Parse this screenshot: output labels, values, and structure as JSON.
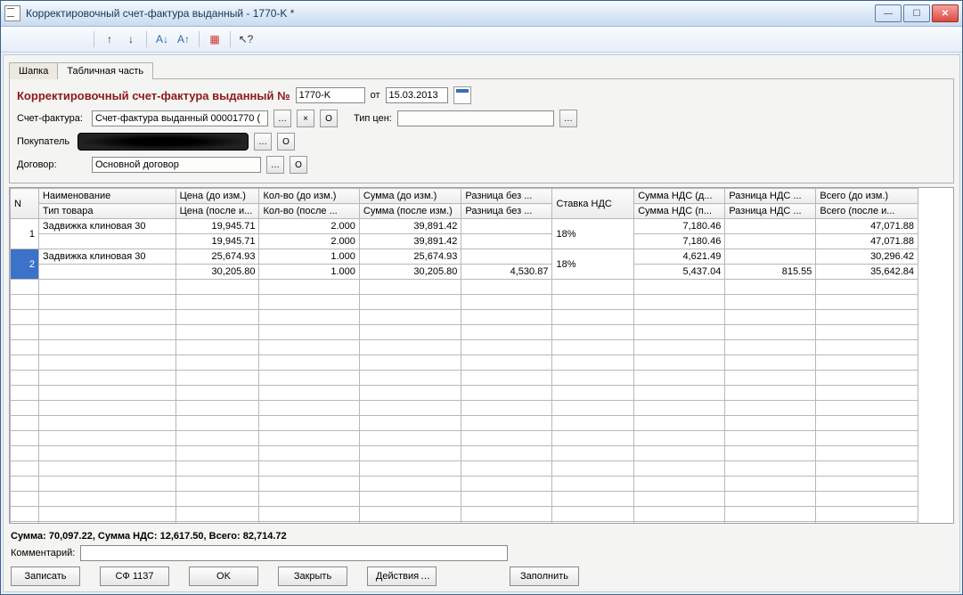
{
  "window": {
    "title": "Корректировочный счет-фактура выданный - 1770-K *"
  },
  "toolbar": {
    "buttons": [
      "grid1",
      "grid2",
      "grid3",
      "grid4",
      "up",
      "down",
      "sort-asc",
      "sort-desc",
      "props",
      "pointer"
    ]
  },
  "tabs": {
    "header": "Шапка",
    "table": "Табличная часть"
  },
  "doc": {
    "title_text": "Корректировочный счет-фактура выданный №",
    "number": "1770-K",
    "from_label": "от",
    "date": "15.03.2013",
    "invoice_label": "Счет-фактура:",
    "invoice_value": "Счет-фактура выданный 00001770 (",
    "pricetype_label": "Тип цен:",
    "pricetype_value": "",
    "buyer_label": "Покупатель",
    "contract_label": "Договор:",
    "contract_value": "Основной договор"
  },
  "columns": {
    "n": "N",
    "name_top": "Наименование",
    "name_bot": "Тип товара",
    "price_top": "Цена (до изм.)",
    "price_bot": "Цена (после и...",
    "qty_top": "Кол-во (до изм.)",
    "qty_bot": "Кол-во (после ...",
    "sum_top": "Сумма (до изм.)",
    "sum_bot": "Сумма (после изм.)",
    "diff_top": "Разница без ...",
    "diff_bot": "Разница без ...",
    "vat": "Ставка НДС",
    "vatsum_top": "Сумма НДС (д...",
    "vatsum_bot": "Сумма НДС (п...",
    "vatdiff_top": "Разница НДС ...",
    "vatdiff_bot": "Разница НДС ...",
    "total_top": "Всего (до изм.)",
    "total_bot": "Всего (после и..."
  },
  "rows": [
    {
      "n": "1",
      "name": "Задвижка клиновая 30",
      "price_b": "19,945.71",
      "price_a": "19,945.71",
      "qty_b": "2.000",
      "qty_a": "2.000",
      "sum_b": "39,891.42",
      "sum_a": "39,891.42",
      "diff_b": "",
      "diff_a": "",
      "vat": "18%",
      "vatsum_b": "7,180.46",
      "vatsum_a": "7,180.46",
      "vatdiff_b": "",
      "vatdiff_a": "",
      "total_b": "47,071.88",
      "total_a": "47,071.88"
    },
    {
      "n": "2",
      "name": "Задвижка клиновая 30",
      "price_b": "25,674.93",
      "price_a": "30,205.80",
      "qty_b": "1.000",
      "qty_a": "1.000",
      "sum_b": "25,674.93",
      "sum_a": "30,205.80",
      "diff_b": "",
      "diff_a": "4,530.87",
      "vat": "18%",
      "vatsum_b": "4,621.49",
      "vatsum_a": "5,437.04",
      "vatdiff_b": "",
      "vatdiff_a": "815.55",
      "total_b": "30,296.42",
      "total_a": "35,642.84"
    }
  ],
  "totals_line": "Сумма:  70,097.22, Сумма НДС:  12,617.50, Всего:  82,714.72",
  "comment_label": "Комментарий:",
  "comment_value": "",
  "buttons": {
    "write": "Записать",
    "sf1137": "СФ 1137",
    "ok": "OK",
    "close": "Закрыть",
    "actions": "Действия",
    "fill": "Заполнить"
  }
}
